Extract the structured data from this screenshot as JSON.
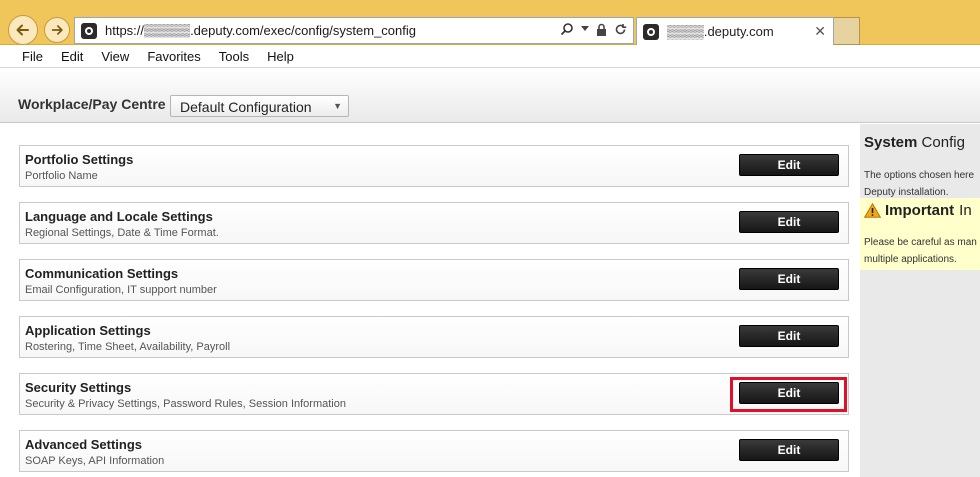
{
  "browser": {
    "url": "https://▒▒▒▒▒.deputy.com/exec/config/system_config",
    "tab_title": "▒▒▒▒.deputy.com",
    "menu": [
      "File",
      "Edit",
      "View",
      "Favorites",
      "Tools",
      "Help"
    ]
  },
  "header": {
    "workplace_label": "Workplace/Pay Centre",
    "config_selected": "Default Configuration"
  },
  "settings": [
    {
      "title": "Portfolio Settings",
      "desc": "Portfolio Name",
      "button": "Edit"
    },
    {
      "title": "Language and Locale Settings",
      "desc": "Regional Settings, Date & Time Format.",
      "button": "Edit"
    },
    {
      "title": "Communication Settings",
      "desc": "Email Configuration, IT support number",
      "button": "Edit"
    },
    {
      "title": "Application Settings",
      "desc": "Rostering, Time Sheet, Availability, Payroll",
      "button": "Edit"
    },
    {
      "title": "Security Settings",
      "desc": "Security & Privacy Settings, Password Rules, Session Information",
      "button": "Edit"
    },
    {
      "title": "Advanced Settings",
      "desc": "SOAP Keys, API Information",
      "button": "Edit"
    }
  ],
  "sidebar": {
    "title_bold": "System",
    "title_rest": "Config",
    "text_line1": "The options chosen here",
    "text_line2": "Deputy installation.",
    "notice_title": "Important",
    "notice_title_rest": "In",
    "notice_line1": "Please be careful as man",
    "notice_line2": "multiple applications."
  },
  "colors": {
    "chrome": "#f0c65a",
    "highlight": "#e0102a",
    "button": "#1f1f1f",
    "notice": "#ffffcc"
  },
  "icons": [
    "back-arrow-icon",
    "forward-arrow-icon",
    "search-icon",
    "dropdown-icon",
    "lock-icon",
    "refresh-icon",
    "close-icon",
    "warning-icon"
  ]
}
